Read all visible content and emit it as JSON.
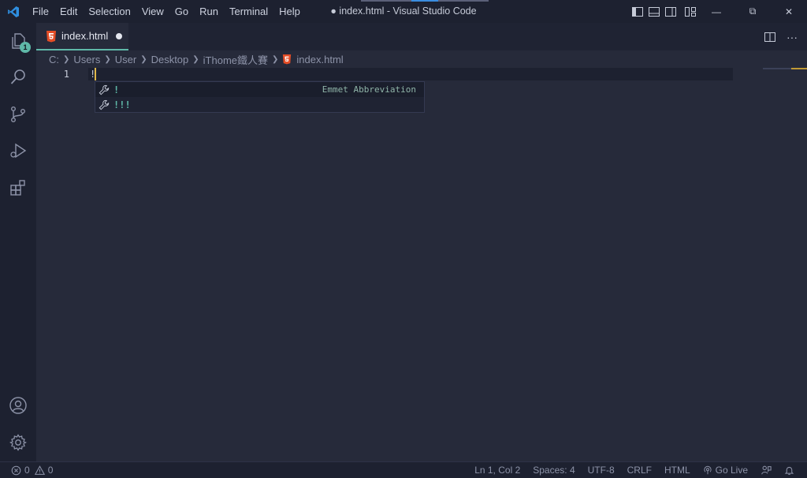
{
  "titlebar": {
    "menu": [
      "File",
      "Edit",
      "Selection",
      "View",
      "Go",
      "Run",
      "Terminal",
      "Help"
    ],
    "window_title": "● index.html - Visual Studio Code",
    "controls": {
      "minimize": "—",
      "restore": "⧉",
      "close": "✕"
    }
  },
  "activity_bar": {
    "items": [
      "explorer",
      "search",
      "source-control",
      "run-and-debug",
      "extensions"
    ],
    "explorer_badge": "1",
    "bottom": [
      "accounts",
      "manage"
    ]
  },
  "tabs": [
    {
      "label": "index.html",
      "modified": true,
      "icon": "html5-icon"
    }
  ],
  "tab_actions": {
    "more": "···"
  },
  "breadcrumb": [
    "C:",
    "Users",
    "User",
    "Desktop",
    "iThome鐵人賽",
    "index.html"
  ],
  "editor": {
    "lines": [
      {
        "number": "1",
        "text": "!"
      }
    ]
  },
  "suggest": {
    "items": [
      {
        "label": "!",
        "detail": "Emmet Abbreviation",
        "selected": true
      },
      {
        "label": "!!!",
        "detail": "",
        "selected": false
      }
    ]
  },
  "statusbar": {
    "errors": "0",
    "warnings": "0",
    "position": "Ln 1, Col 2",
    "spaces": "Spaces: 4",
    "encoding": "UTF-8",
    "eol": "CRLF",
    "language": "HTML",
    "go_live": "Go Live"
  },
  "colors": {
    "accent": "#5fb8a8",
    "background": "#262a3a",
    "sidebar": "#1d2130",
    "cursor": "#e0b84a",
    "html_icon": "#e44d26",
    "vscode_blue": "#2f8fe0"
  }
}
